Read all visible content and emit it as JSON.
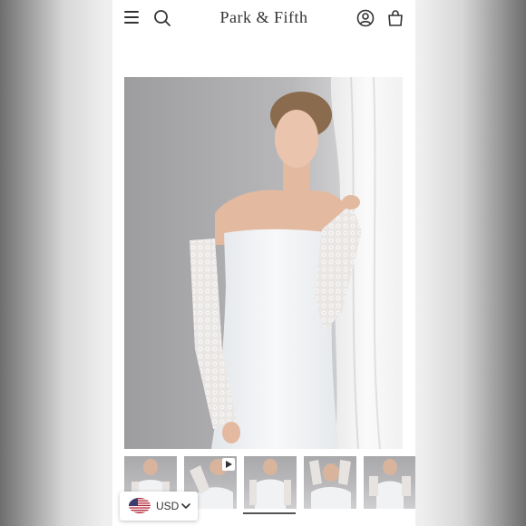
{
  "header": {
    "brand": "Park & Fifth",
    "icons": [
      "menu-icon",
      "search-icon",
      "account-icon",
      "shopping-bag-icon"
    ]
  },
  "product": {
    "thumbnail_count": 5,
    "active_thumbnail_index": 2,
    "video_thumbnail_index": 1
  },
  "currency_selector": {
    "label": "USD",
    "flag": "us-flag-icon"
  },
  "colors": {
    "background": "#ffffff",
    "text": "#333333",
    "dress": "#f4f6f8"
  }
}
